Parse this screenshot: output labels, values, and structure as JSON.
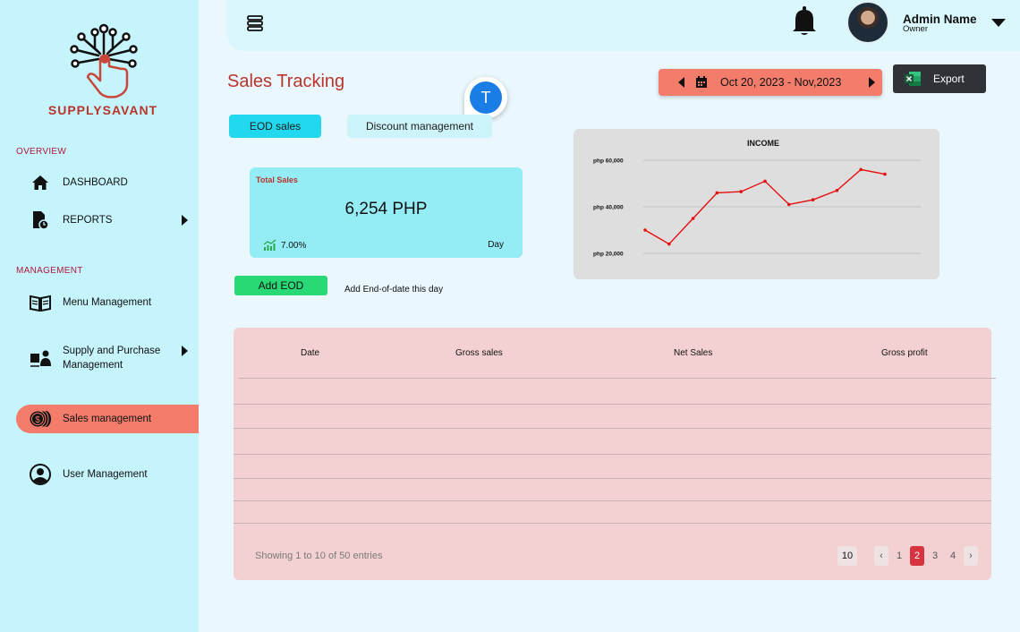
{
  "brand": {
    "name": "SUPPLYSAVANT"
  },
  "sidebar": {
    "overview_label": "OVERVIEW",
    "management_label": "MANAGEMENT",
    "items": [
      {
        "label": "DASHBOARD",
        "icon": "home-icon"
      },
      {
        "label": "REPORTS",
        "icon": "reports-icon"
      },
      {
        "label": "Menu Management",
        "icon": "menu-book-icon"
      },
      {
        "label_line1": "Supply and Purchase",
        "label_line2": "Management",
        "icon": "supply-icon"
      },
      {
        "label": "Sales management",
        "icon": "sales-coins-icon",
        "active": true
      },
      {
        "label": "User Management",
        "icon": "user-circle-icon"
      }
    ]
  },
  "header": {
    "user_name": "Admin Name",
    "user_role": "Owner"
  },
  "page": {
    "title": "Sales Tracking",
    "date_range": "Oct 20, 2023 - Nov,2023",
    "export_label": "Export",
    "floating_avatar_letter": "T"
  },
  "tabs": [
    {
      "label": "EOD sales",
      "active": true
    },
    {
      "label": "Discount management",
      "active": false
    }
  ],
  "summary_card": {
    "label": "Total Sales",
    "value": "6,254 PHP",
    "change": "7.00%",
    "period": "Day"
  },
  "add_eod": {
    "button_label": "Add EOD",
    "hint": "Add End-of-date this day"
  },
  "chart_data": {
    "type": "line",
    "title": "INCOME",
    "ytick_labels": [
      "php 60,000",
      "php 40,000",
      "php 20,000"
    ],
    "yticks": [
      60000,
      40000,
      20000
    ],
    "ylim": [
      20000,
      60000
    ],
    "grid": true,
    "series": [
      {
        "values": [
          30000,
          24000,
          35000,
          46000,
          46500,
          51000,
          41000,
          43000,
          47000,
          56000,
          54000
        ],
        "color": "#e60f0f"
      }
    ]
  },
  "table": {
    "columns": [
      "Date",
      "Gross sales",
      "Net Sales",
      "Gross profit"
    ],
    "footer_text": "Showing 1 to 10 of 50 entries",
    "page_size": "10",
    "pages": [
      "1",
      "2",
      "3",
      "4"
    ],
    "current_page": "2",
    "prev_symbol": "‹",
    "next_symbol": "›"
  },
  "colors": {
    "sidebar_bg": "#c5f4fc",
    "accent_coral": "#f47c6b",
    "brand_red": "#b7352b",
    "chart_line": "#e60f0f"
  }
}
